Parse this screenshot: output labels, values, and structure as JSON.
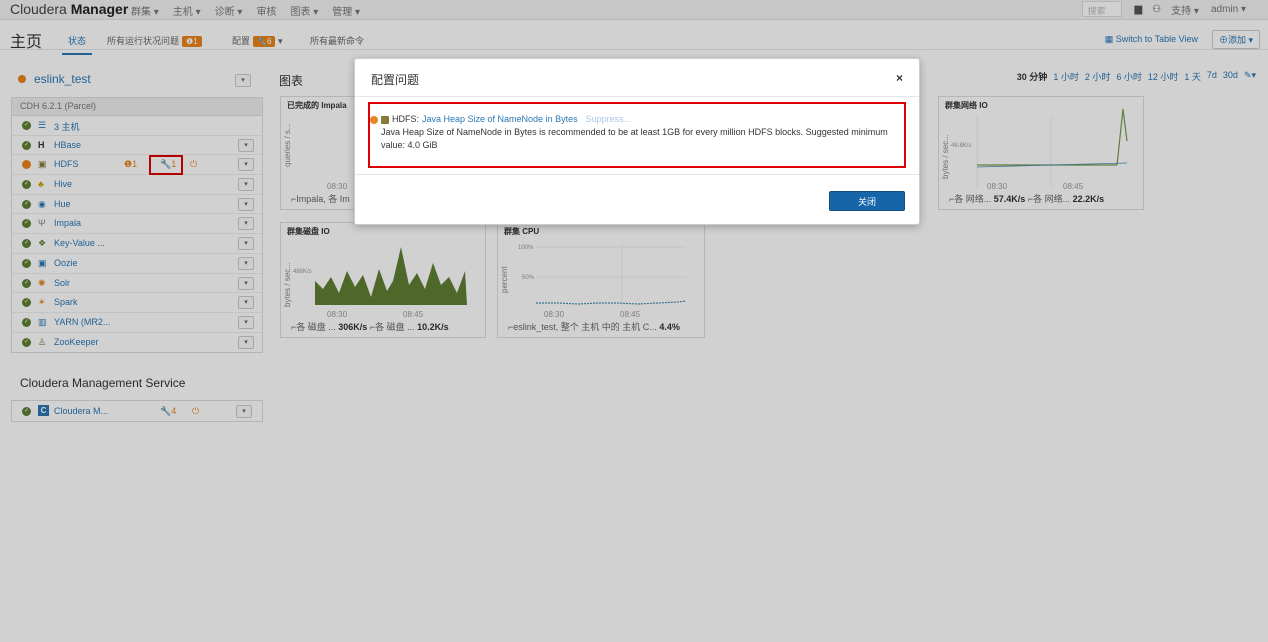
{
  "topbar": {
    "brand_light": "Cloudera ",
    "brand_bold": "Manager",
    "nav": [
      "群集 ▾",
      "主机 ▾",
      "诊断 ▾",
      "审核",
      "图表 ▾",
      "管理 ▾"
    ],
    "search_placeholder": "搜索",
    "support": "支持 ▾",
    "user": "admin ▾"
  },
  "subbar": {
    "title": "主页",
    "tab_status": "状态",
    "tab_issues": "所有运行状况问题",
    "issues_count": "❶1",
    "tab_config": "配置",
    "config_count": "🔧6",
    "config_caret": "▾",
    "tab_commands": "所有最新命令",
    "table_view": "▦ Switch to Table View",
    "add": "⊕添加 ▾"
  },
  "cluster": {
    "name": "eslink_test",
    "cdh": "CDH 6.2.1 (Parcel)",
    "services": [
      {
        "icon": "☰",
        "name": "3 主机",
        "status": "ok"
      },
      {
        "icon": "H",
        "name": "HBase",
        "status": "ok"
      },
      {
        "icon": "▣",
        "name": "HDFS",
        "status": "warn"
      },
      {
        "icon": "♣",
        "name": "Hive",
        "status": "ok"
      },
      {
        "icon": "◉",
        "name": "Hue",
        "status": "ok"
      },
      {
        "icon": "Ψ",
        "name": "Impala",
        "status": "ok"
      },
      {
        "icon": "❖",
        "name": "Key-Value ...",
        "status": "ok"
      },
      {
        "icon": "▣",
        "name": "Oozie",
        "status": "ok"
      },
      {
        "icon": "✺",
        "name": "Solr",
        "status": "ok"
      },
      {
        "icon": "✶",
        "name": "Spark",
        "status": "ok"
      },
      {
        "icon": "▥",
        "name": "YARN (MR2...",
        "status": "ok"
      },
      {
        "icon": "♙",
        "name": "ZooKeeper",
        "status": "ok"
      }
    ],
    "hdfs_health": "❶1",
    "hdfs_config": "🔧1",
    "hdfs_power": "⏻"
  },
  "mgmt": {
    "title": "Cloudera Management Service",
    "icon": "C",
    "name": "Cloudera M...",
    "config": "🔧4",
    "power": "⏻"
  },
  "charts": {
    "title": "图表",
    "times": [
      "30 分钟",
      "1 小时",
      "2 小时",
      "6 小时",
      "12 小时",
      "1 天",
      "7d",
      "30d",
      "✎▾"
    ],
    "impala": {
      "title": "已完成的 Impala",
      "ylabel": "queries / s...",
      "x1": "08:30",
      "legend": "⌐Impala, 各 Im"
    },
    "net": {
      "title": "群集网络 IO",
      "ylabel": "bytes / sec...",
      "grid": "48.8K/s",
      "x1": "08:30",
      "x2": "08:45",
      "legend1": "⌐各 网络...",
      "val1": "57.4K/s",
      "legend2": "⌐各 网络...",
      "val2": "22.2K/s"
    },
    "disk": {
      "title": "群集磁盘 IO",
      "ylabel": "bytes / sec...",
      "grid": "488K/s",
      "x1": "08:30",
      "x2": "08:45",
      "legend1": "⌐各 磁盘 ...",
      "val1": "306K/s",
      "legend2": "⌐各 磁盘 ...",
      "val2": "10.2K/s"
    },
    "cpu": {
      "title": "群集 CPU",
      "ylabel": "percent",
      "grid1": "100%",
      "grid2": "50%",
      "x1": "08:30",
      "x2": "08:45",
      "legend": "⌐eslink_test, 整个 主机 中的 主机 C...",
      "val": "4.4%"
    }
  },
  "modal": {
    "title": "配置问题",
    "close_x": "×",
    "service": "HDFS:",
    "issue_link": "Java Heap Size of NameNode in Bytes",
    "suppress": "Suppress...",
    "message": "Java Heap Size of NameNode in Bytes is recommended to be at least 1GB for every million HDFS blocks. Suggested minimum value: 4.0 GiB",
    "close_button": "关闭"
  }
}
